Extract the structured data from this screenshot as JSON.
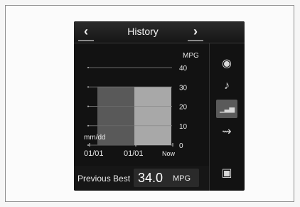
{
  "header": {
    "title": "History",
    "back_icon": "chevron-left-icon",
    "forward_icon": "chevron-right-icon"
  },
  "chart_data": {
    "type": "bar",
    "ylabel": "MPG",
    "xlabel": "mm/dd",
    "ylim": [
      0,
      40
    ],
    "yticks": [
      "40",
      "30",
      "20",
      "10",
      "0"
    ],
    "categories": [
      "01/01",
      "01/01",
      "Now"
    ],
    "values": [
      30,
      30
    ],
    "bar_colors": [
      "#595959",
      "#a8a8a8"
    ],
    "grid": true
  },
  "footer": {
    "label": "Previous Best",
    "value": "34.0",
    "unit": "MPG"
  },
  "sidebar": {
    "items": [
      {
        "icon": "radio-icon",
        "glyph": "◉",
        "active": false
      },
      {
        "icon": "music-note-icon",
        "glyph": "♪",
        "active": false
      },
      {
        "icon": "history-chart-icon",
        "glyph": "▁▃▅",
        "active": true
      },
      {
        "icon": "fuel-economy-icon",
        "glyph": "⇝",
        "active": false
      },
      {
        "icon": "display-icon",
        "glyph": "▣",
        "active": false
      }
    ]
  }
}
